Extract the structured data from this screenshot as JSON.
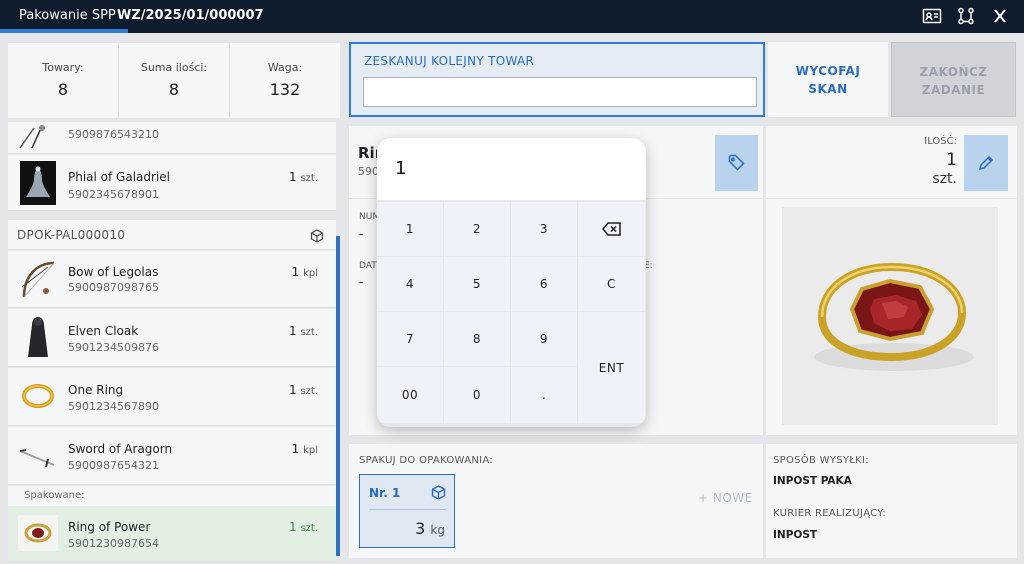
{
  "header": {
    "app_name": "Pakowanie SPP",
    "doc_number": "WZ/2025/01/000007",
    "progress_pct": 12.5
  },
  "stats": [
    {
      "label": "Towary:",
      "value": "8"
    },
    {
      "label": "Suma ilości:",
      "value": "8"
    },
    {
      "label": "Waga:",
      "value": "132"
    }
  ],
  "list": {
    "top_items": [
      {
        "name": "",
        "code": "5909876543210",
        "qty": "",
        "unit": ""
      },
      {
        "name": "Phial of Galadriel",
        "code": "5902345678901",
        "qty": "1",
        "unit": "szt."
      }
    ],
    "group_label": "DPOK-PAL000010",
    "group_items": [
      {
        "name": "Bow of Legolas",
        "code": "5900987098765",
        "qty": "1",
        "unit": "kpl"
      },
      {
        "name": "Elven Cloak",
        "code": "5901234509876",
        "qty": "1",
        "unit": "szt."
      },
      {
        "name": "One Ring",
        "code": "5901234567890",
        "qty": "1",
        "unit": "szt."
      },
      {
        "name": "Sword of Aragorn",
        "code": "5900987654321",
        "qty": "1",
        "unit": "kpl"
      }
    ],
    "packed_label": "Spakowane:",
    "packed_items": [
      {
        "name": "Ring of Power",
        "code": "5901230987654",
        "qty": "1",
        "unit": "szt."
      }
    ]
  },
  "scan": {
    "label": "ZESKANUJ KOLEJNY TOWAR",
    "value": "",
    "placeholder": ""
  },
  "actions": {
    "undo_line1": "WYCOFAJ",
    "undo_line2": "SKAN",
    "finish_line1": "ZAKOŃCZ",
    "finish_line2": "ZADANIE"
  },
  "detail": {
    "name_visible": "Rin",
    "code_visible": "590",
    "qty_label": "ILOŚĆ:",
    "qty_value": "1",
    "qty_unit": "szt.",
    "field1_label": "NUM",
    "field1_value": "-",
    "field2_label": "DAT",
    "field2_value": "-",
    "field3_label": "E:"
  },
  "packing": {
    "label": "SPAKUJ DO OPAKOWANIA:",
    "packages": [
      {
        "name": "Nr. 1",
        "weight": "3",
        "unit": "kg"
      }
    ],
    "new_label": "+ NOWE"
  },
  "shipping": {
    "method_label": "SPOSÓB WYSYŁKI:",
    "method_value": "INPOST PAKA",
    "courier_label": "KURIER REALIZUJĄCY:",
    "courier_value": "INPOST"
  },
  "keypad": {
    "display": "1",
    "keys": [
      "1",
      "2",
      "3",
      "backspace",
      "4",
      "5",
      "6",
      "C",
      "7",
      "8",
      "9",
      "ENT",
      "00",
      "0",
      "."
    ]
  },
  "icons": {
    "header": [
      "id-card-icon",
      "route-icon",
      "close-icon"
    ],
    "group": "package-icon",
    "tag": "tag-icon",
    "edit": "pencil-icon",
    "backspace": "backspace-icon"
  },
  "colors": {
    "header_bg": "#0f1c2e",
    "accent": "#2f7dd4",
    "button_bg": "#b9d3ee",
    "packed_bg": "#e3efe2",
    "packed_qty": "#3a8a3a"
  }
}
